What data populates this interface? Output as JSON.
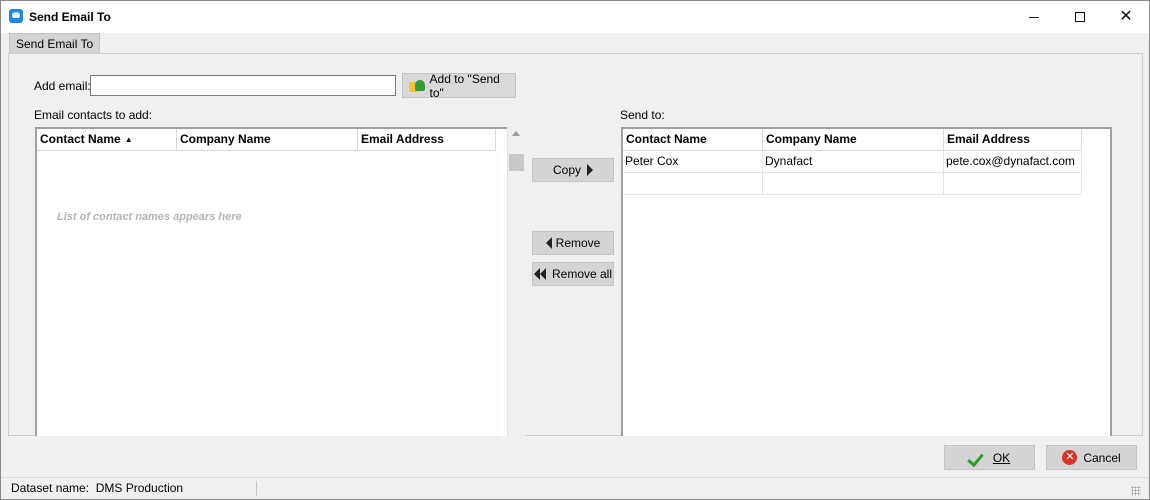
{
  "window": {
    "title": "Send Email To",
    "icons": {
      "app": "app-logo-icon",
      "minimize": "minimize-icon",
      "maximize": "maximize-icon",
      "close": "close-icon"
    },
    "close_glyph": "✕"
  },
  "tabs": [
    {
      "label": "Send Email To",
      "selected": true
    }
  ],
  "add_email": {
    "label": "Add email:",
    "value": "",
    "placeholder": "",
    "button_label": "Add to \"Send to\"",
    "button_icon": "contacts-add-icon"
  },
  "contacts": {
    "label": "Email contacts to add:",
    "columns": [
      "Contact Name",
      "Company Name",
      "Email Address"
    ],
    "sort_column": "Contact Name",
    "sort_glyph": "▲",
    "rows": [],
    "empty_text": "List of contact names appears here"
  },
  "actions": {
    "copy_label": "Copy",
    "remove_label": "Remove",
    "remove_all_label": "Remove all"
  },
  "send_to": {
    "label": "Send to:",
    "columns": [
      "Contact Name",
      "Company Name",
      "Email Address"
    ],
    "rows": [
      {
        "contact_name": "Peter Cox",
        "company_name": "Dynafact",
        "email": "pete.cox@dynafact.com"
      },
      {
        "contact_name": "",
        "company_name": "",
        "email": ""
      }
    ]
  },
  "dialog_buttons": {
    "ok_label": "OK",
    "ok_icon": "checkmark-icon",
    "cancel_label": "Cancel",
    "cancel_icon": "cancel-circle-icon",
    "cancel_glyph": "✕"
  },
  "status_bar": {
    "text": "Dataset name:  DMS Production"
  },
  "colors": {
    "accent": "#1e88d8",
    "ok_green": "#2d9a2d",
    "cancel_red": "#d8342b",
    "placeholder_grey": "#b4b4b4"
  }
}
